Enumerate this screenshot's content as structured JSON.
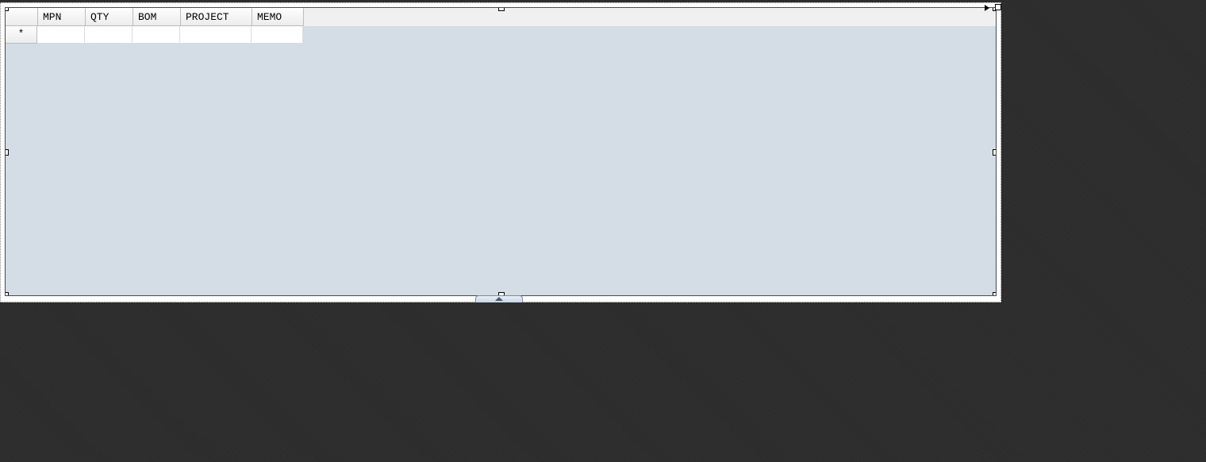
{
  "grid": {
    "columns": {
      "mpn": "MPN",
      "qty": "QTY",
      "bom": "BOM",
      "proj": "PROJECT",
      "memo": "MEMO"
    },
    "new_row_indicator": "*",
    "rows": [
      {
        "mpn": "",
        "qty": "",
        "bom": "",
        "proj": "",
        "memo": ""
      }
    ]
  }
}
